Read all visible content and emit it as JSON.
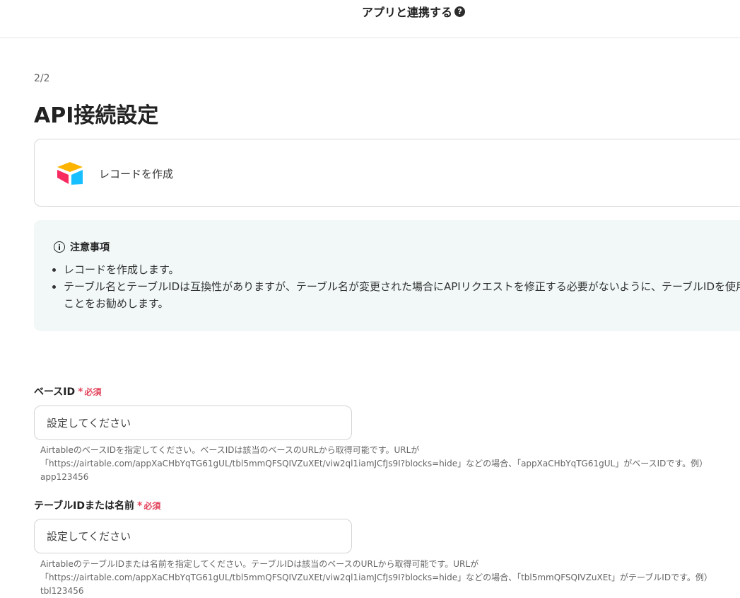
{
  "header": {
    "title": "アプリと連携する",
    "help_icon_glyph": "?"
  },
  "step": "2/2",
  "page_title": "API接続設定",
  "action": {
    "label": "レコードを作成",
    "icon": "airtable-logo"
  },
  "notice": {
    "title": "注意事項",
    "items": [
      "レコードを作成します。",
      "テーブル名とテーブルIDは互換性がありますが、テーブル名が変更された場合にAPIリクエストを修正する必要がないように、テーブルIDを使用することをお勧めします。"
    ]
  },
  "fields": [
    {
      "label": "ベースID",
      "required_mark": "*",
      "required_text": "必須",
      "placeholder": "設定してください",
      "help": "AirtableのベースIDを指定してください。ベースIDは該当のベースのURLから取得可能です。URLが「https://airtable.com/appXaCHbYqTG61gUL/tbl5mmQFSQIVZuXEt/viw2ql1iamJCfJs9I?blocks=hide」などの場合、「appXaCHbYqTG61gUL」がベースIDです。例）app123456"
    },
    {
      "label": "テーブルIDまたは名前",
      "required_mark": "*",
      "required_text": "必須",
      "placeholder": "設定してください",
      "help": "AirtableのテーブルIDまたは名前を指定してください。テーブルIDは該当のベースのURLから取得可能です。URLが「https://airtable.com/appXaCHbYqTG61gUL/tbl5mmQFSQIVZuXEt/viw2ql1iamJCfJs9I?blocks=hide」などの場合、「tbl5mmQFSQIVZuXEt」がテーブルIDです。例）tbl123456"
    }
  ],
  "colors": {
    "required": "#e2445c",
    "notice_bg": "#f1f8f7",
    "border": "#d9d9d9"
  }
}
